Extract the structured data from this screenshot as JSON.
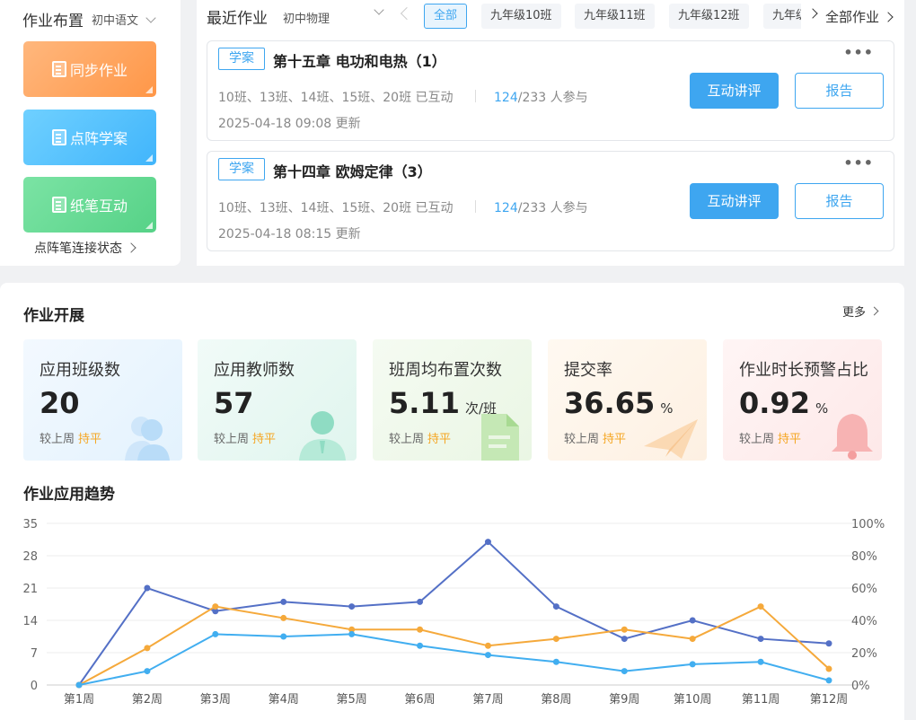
{
  "left_panel": {
    "title": "作业布置",
    "subject": "初中语文",
    "buttons": [
      {
        "label": "同步作业",
        "icon": "book-icon"
      },
      {
        "label": "点阵学案",
        "icon": "note-icon"
      },
      {
        "label": "纸笔互动",
        "icon": "document-icon"
      }
    ],
    "status_link": "点阵笔连接状态"
  },
  "recent": {
    "title": "最近作业",
    "subject": "初中物理",
    "tabs": [
      "全部",
      "九年级10班",
      "九年级11班",
      "九年级12班",
      "九年级"
    ],
    "active_tab": "全部",
    "all_link": "全部作业",
    "cards": [
      {
        "tag": "学案",
        "title": "第十五章 电功和电热（1）",
        "classes": "10班、13班、14班、15班、20班 已互动",
        "participated": "124",
        "participants_rest": "/233 人参与",
        "time": "2025-04-18 09:08 更新",
        "primary_button": "互动讲评",
        "secondary_button": "报告"
      },
      {
        "tag": "学案",
        "title": "第十四章 欧姆定律（3）",
        "classes": "10班、13班、14班、15班、20班 已互动",
        "participated": "124",
        "participants_rest": "/233 人参与",
        "time": "2025-04-18 08:15 更新",
        "primary_button": "互动讲评",
        "secondary_button": "报告"
      }
    ]
  },
  "homework_stats": {
    "title": "作业开展",
    "more": "更多",
    "items": [
      {
        "label": "应用班级数",
        "value": "20",
        "unit": "",
        "compare_text": "较上周",
        "trend": "持平"
      },
      {
        "label": "应用教师数",
        "value": "57",
        "unit": "",
        "compare_text": "较上周",
        "trend": "持平"
      },
      {
        "label": "班周均布置次数",
        "value": "5.11",
        "unit": "次/班",
        "compare_text": "较上周",
        "trend": "持平"
      },
      {
        "label": "提交率",
        "value": "36.65",
        "unit": "%",
        "compare_text": "较上周",
        "trend": "持平"
      },
      {
        "label": "作业时长预警占比",
        "value": "0.92",
        "unit": "%",
        "compare_text": "较上周",
        "trend": "持平"
      }
    ]
  },
  "trend": {
    "title": "作业应用趋势"
  },
  "colors": {
    "accent": "#3ea6f0",
    "trend": "#f5a623",
    "series_dark_blue": "#5470c6",
    "series_orange": "#f5a93b",
    "series_light_blue": "#41aef0"
  },
  "chart_data": {
    "type": "line",
    "categories": [
      "第1周",
      "第2周",
      "第3周",
      "第4周",
      "第5周",
      "第6周",
      "第7周",
      "第8周",
      "第9周",
      "第10周",
      "第11周",
      "第12周"
    ],
    "y_left": {
      "ticks": [
        "0",
        "7",
        "14",
        "21",
        "28",
        "35"
      ],
      "range": [
        0,
        35
      ]
    },
    "y_right": {
      "ticks": [
        "0%",
        "20%",
        "40%",
        "60%",
        "80%",
        "100%"
      ],
      "range": [
        0,
        100
      ]
    },
    "grid": true,
    "series": [
      {
        "axis": "left",
        "color": "#5470c6",
        "values": [
          0,
          21,
          16,
          18,
          17,
          18,
          31,
          17,
          10,
          14,
          10,
          9
        ]
      },
      {
        "axis": "left",
        "color": "#f5a93b",
        "values": [
          0,
          8,
          17,
          14.5,
          12,
          12,
          8.5,
          10,
          12,
          10,
          17,
          3.5
        ]
      },
      {
        "axis": "left",
        "color": "#41aef0",
        "values": [
          0,
          3,
          11,
          10.5,
          11,
          8.5,
          6.5,
          5,
          3,
          4.5,
          5,
          1
        ]
      }
    ]
  }
}
